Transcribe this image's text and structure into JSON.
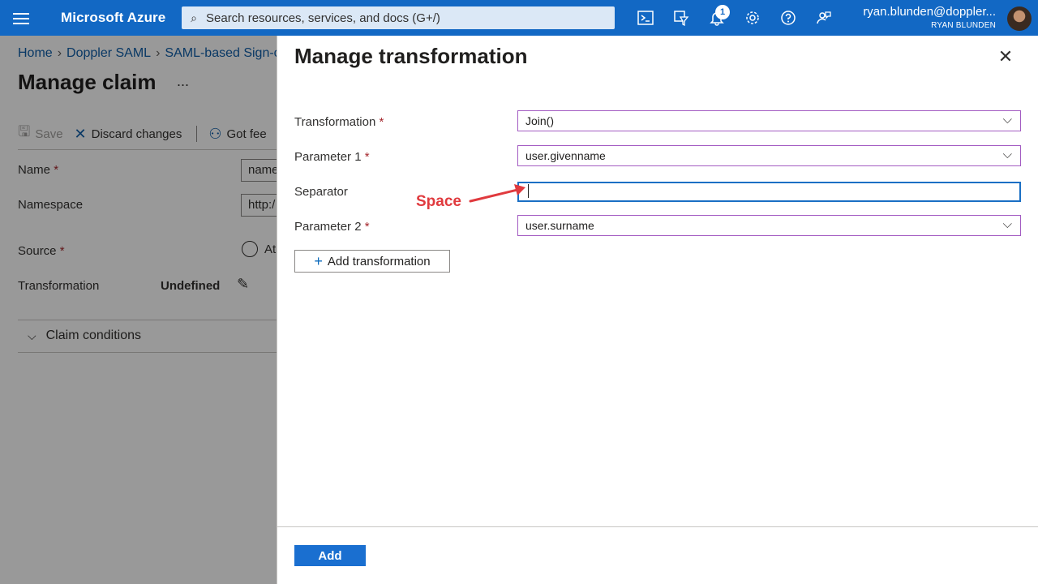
{
  "topbar": {
    "brand": "Microsoft Azure",
    "search_placeholder": "Search resources, services, and docs (G+/)",
    "notification_count": "1",
    "account_email": "ryan.blunden@doppler...",
    "account_name": "RYAN BLUNDEN",
    "icons": [
      "hamburger-icon",
      "search-icon",
      "cloud-shell-icon",
      "directory-filter-icon",
      "bell-icon",
      "gear-icon",
      "help-icon",
      "feedback-icon"
    ]
  },
  "background": {
    "breadcrumbs": [
      "Home",
      "Doppler SAML",
      "SAML-based Sign-o"
    ],
    "title": "Manage claim",
    "more": "...",
    "commands": {
      "save": "Save",
      "discard": "Discard changes",
      "feedback": "Got fee"
    },
    "fields": {
      "name_label": "Name",
      "name_value": "name",
      "namespace_label": "Namespace",
      "namespace_value": "http:/",
      "source_label": "Source",
      "source_option": "At",
      "transformation_label": "Transformation",
      "transformation_value": "Undefined",
      "required_mark": "*"
    },
    "claim_conditions": "Claim conditions"
  },
  "panel": {
    "title": "Manage transformation",
    "rows": {
      "transformation_label": "Transformation",
      "transformation_value": "Join()",
      "param1_label": "Parameter 1",
      "param1_value": "user.givenname",
      "separator_label": "Separator",
      "separator_value": "",
      "param2_label": "Parameter 2",
      "param2_value": "user.surname",
      "required_mark": "*"
    },
    "annotation": "Space",
    "add_transformation": "Add transformation",
    "add_button": "Add"
  },
  "colors": {
    "topbar": "#1268c4",
    "link": "#0f5ea8",
    "required": "#a4262c",
    "annotation": "#e03a3e",
    "primary_button": "#1a6fd0"
  }
}
